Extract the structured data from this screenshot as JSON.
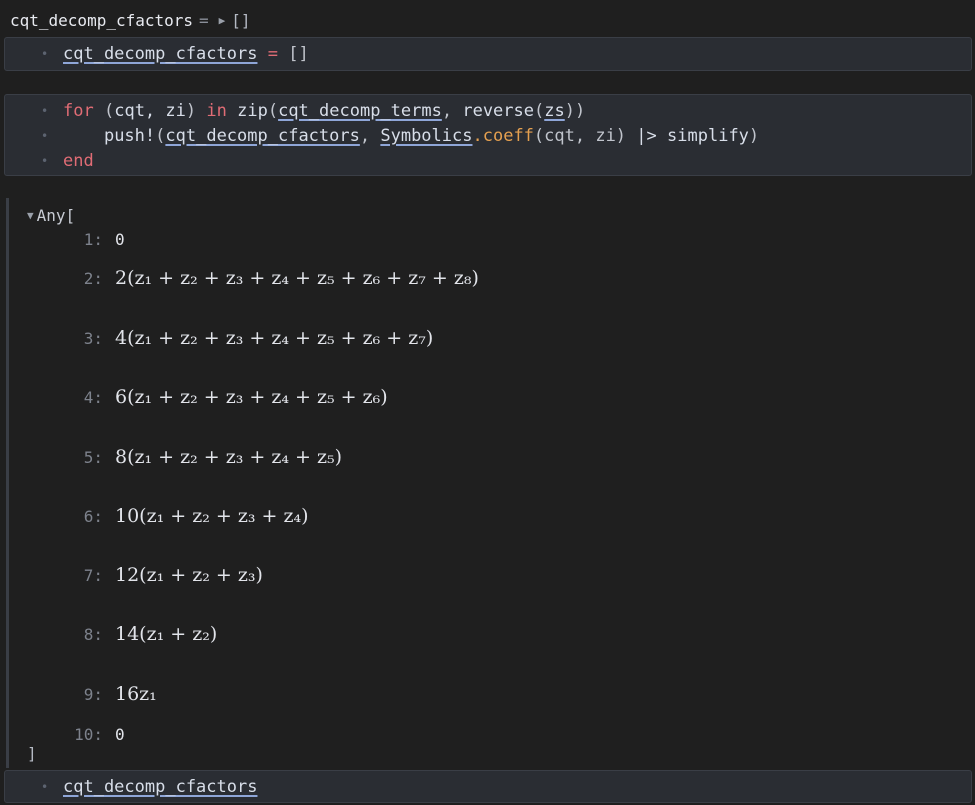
{
  "output_header": {
    "varname": "cqt_decomp_cfactors",
    "eq": "=",
    "value": "[]"
  },
  "cell1": {
    "line1": {
      "name": "cqt_decomp_cfactors",
      "eq": "=",
      "value": "[]"
    }
  },
  "cell2": {
    "line1": {
      "kw_for": "for",
      "lpar": "(",
      "vars": "cqt, zi",
      "rpar": ")",
      "kw_in": "in",
      "zip": "zip",
      "zip_lp": "(",
      "terms": "cqt_decomp_terms",
      "comma": ",",
      "reverse": "reverse",
      "rev_lp": "(",
      "zs": "zs",
      "close": "))"
    },
    "line2": {
      "push": "push!",
      "lp": "(",
      "target": "cqt_decomp_cfactors",
      "comma": ",",
      "module": "Symbolics",
      "dot": ".",
      "method": "coeff",
      "args": "(cqt, zi)",
      "pipe": "|>",
      "simplify": "simplify",
      "rp": ")"
    },
    "line3": {
      "kw_end": "end"
    }
  },
  "array": {
    "head": "Any[",
    "close": "]",
    "entries": [
      {
        "idx": "1:",
        "val": "0"
      },
      {
        "idx": "2:",
        "val": "2(z₁ + z₂ + z₃ + z₄ + z₅ + z₆ + z₇ + z₈)"
      },
      {
        "idx": "3:",
        "val": "4(z₁ + z₂ + z₃ + z₄ + z₅ + z₆ + z₇)"
      },
      {
        "idx": "4:",
        "val": "6(z₁ + z₂ + z₃ + z₄ + z₅ + z₆)"
      },
      {
        "idx": "5:",
        "val": "8(z₁ + z₂ + z₃ + z₄ + z₅)"
      },
      {
        "idx": "6:",
        "val": "10(z₁ + z₂ + z₃ + z₄)"
      },
      {
        "idx": "7:",
        "val": "12(z₁ + z₂ + z₃)"
      },
      {
        "idx": "8:",
        "val": "14(z₁ + z₂)"
      },
      {
        "idx": "9:",
        "val": "16z₁"
      },
      {
        "idx": "10:",
        "val": "0"
      }
    ]
  },
  "cell3": {
    "line1": {
      "name": "cqt_decomp_cfactors"
    }
  }
}
